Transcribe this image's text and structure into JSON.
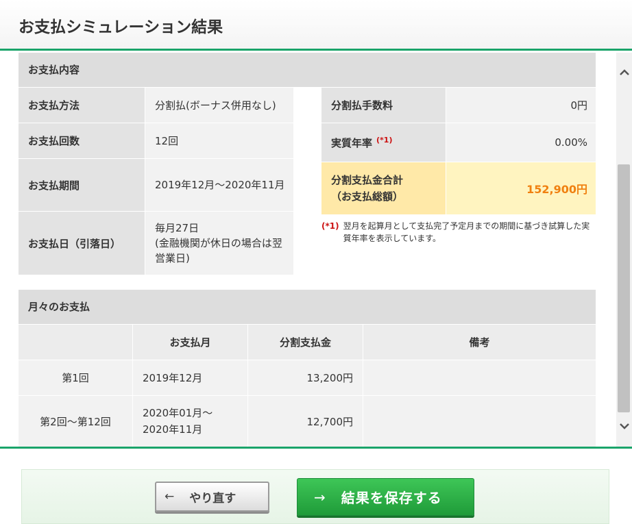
{
  "header": {
    "title": "お支払シミュレーション結果"
  },
  "payment_details": {
    "section_title": "お支払内容",
    "method": {
      "label": "お支払方法",
      "value": "分割払(ボーナス併用なし)"
    },
    "count": {
      "label": "お支払回数",
      "value": "12回"
    },
    "period": {
      "label": "お支払期間",
      "value": "2019年12月～2020年11月"
    },
    "date": {
      "label": "お支払日（引落日）",
      "value": "毎月27日\n(金融機関が休日の場合は翌営業日)"
    },
    "fee": {
      "label": "分割払手数料",
      "value": "0円"
    },
    "apr": {
      "label": "実質年率",
      "note_mark": "(*1)",
      "value": "0.00%"
    },
    "total": {
      "label": "分割支払金合計\n（お支払総額）",
      "value": "152,900円"
    },
    "footnote": {
      "mark": "(*1)",
      "text": "翌月を起算月として支払完了予定月までの期間に基づき試算した実質年率を表示しています。"
    }
  },
  "monthly": {
    "section_title": "月々のお支払",
    "headers": [
      "",
      "お支払月",
      "分割支払金",
      "備考"
    ],
    "rows": [
      {
        "label": "第1回",
        "month": "2019年12月",
        "amount": "13,200円",
        "note": ""
      },
      {
        "label": "第2回～第12回",
        "month": "2020年01月～\n2020年11月",
        "amount": "12,700円",
        "note": ""
      }
    ]
  },
  "buttons": {
    "redo": {
      "arrow": "←",
      "label": "やり直す"
    },
    "save": {
      "arrow": "→",
      "label": "結果を保存する"
    }
  },
  "colors": {
    "accent_green": "#1aa46a",
    "highlight": "#fff4c0",
    "total_orange": "#f08010",
    "note_red": "#cc1111"
  }
}
